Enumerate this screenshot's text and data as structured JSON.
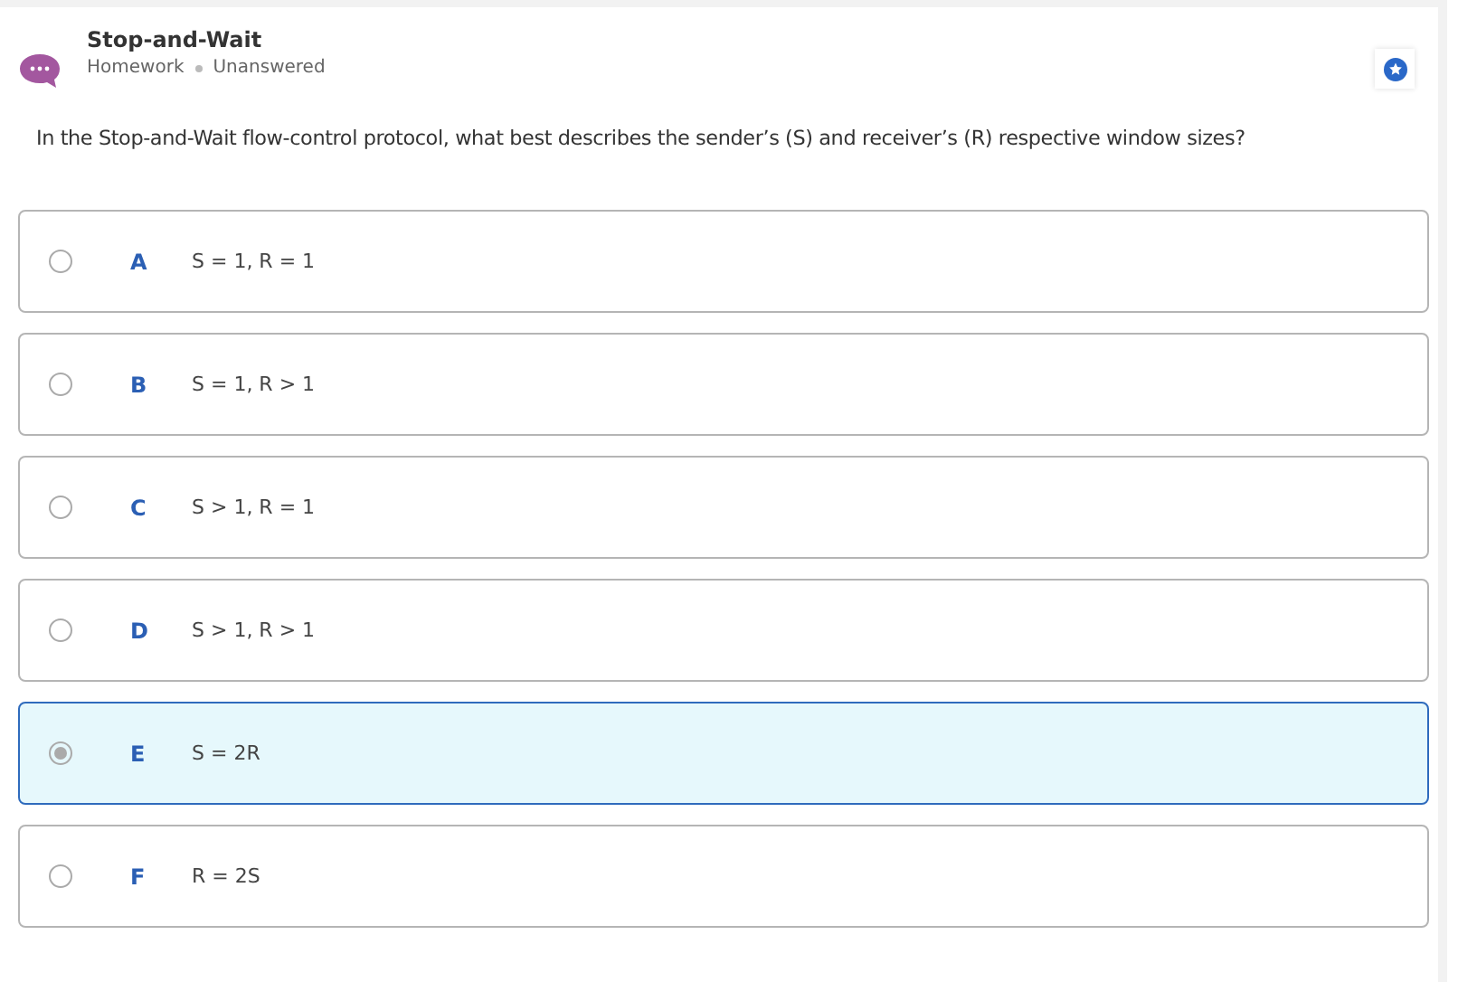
{
  "header": {
    "title": "Stop-and-Wait",
    "meta": [
      "Homework",
      "Unanswered"
    ]
  },
  "question": "In the Stop-and-Wait flow-control protocol, what best describes the sender’s (S) and receiver’s (R) respective window sizes?",
  "options": [
    {
      "letter": "A",
      "text": "S = 1, R = 1",
      "selected": false
    },
    {
      "letter": "B",
      "text": "S = 1, R > 1",
      "selected": false
    },
    {
      "letter": "C",
      "text": "S > 1, R = 1",
      "selected": false
    },
    {
      "letter": "D",
      "text": "S > 1, R > 1",
      "selected": false
    },
    {
      "letter": "E",
      "text": "S = 2R",
      "selected": true
    },
    {
      "letter": "F",
      "text": "R = 2S",
      "selected": false
    }
  ]
}
